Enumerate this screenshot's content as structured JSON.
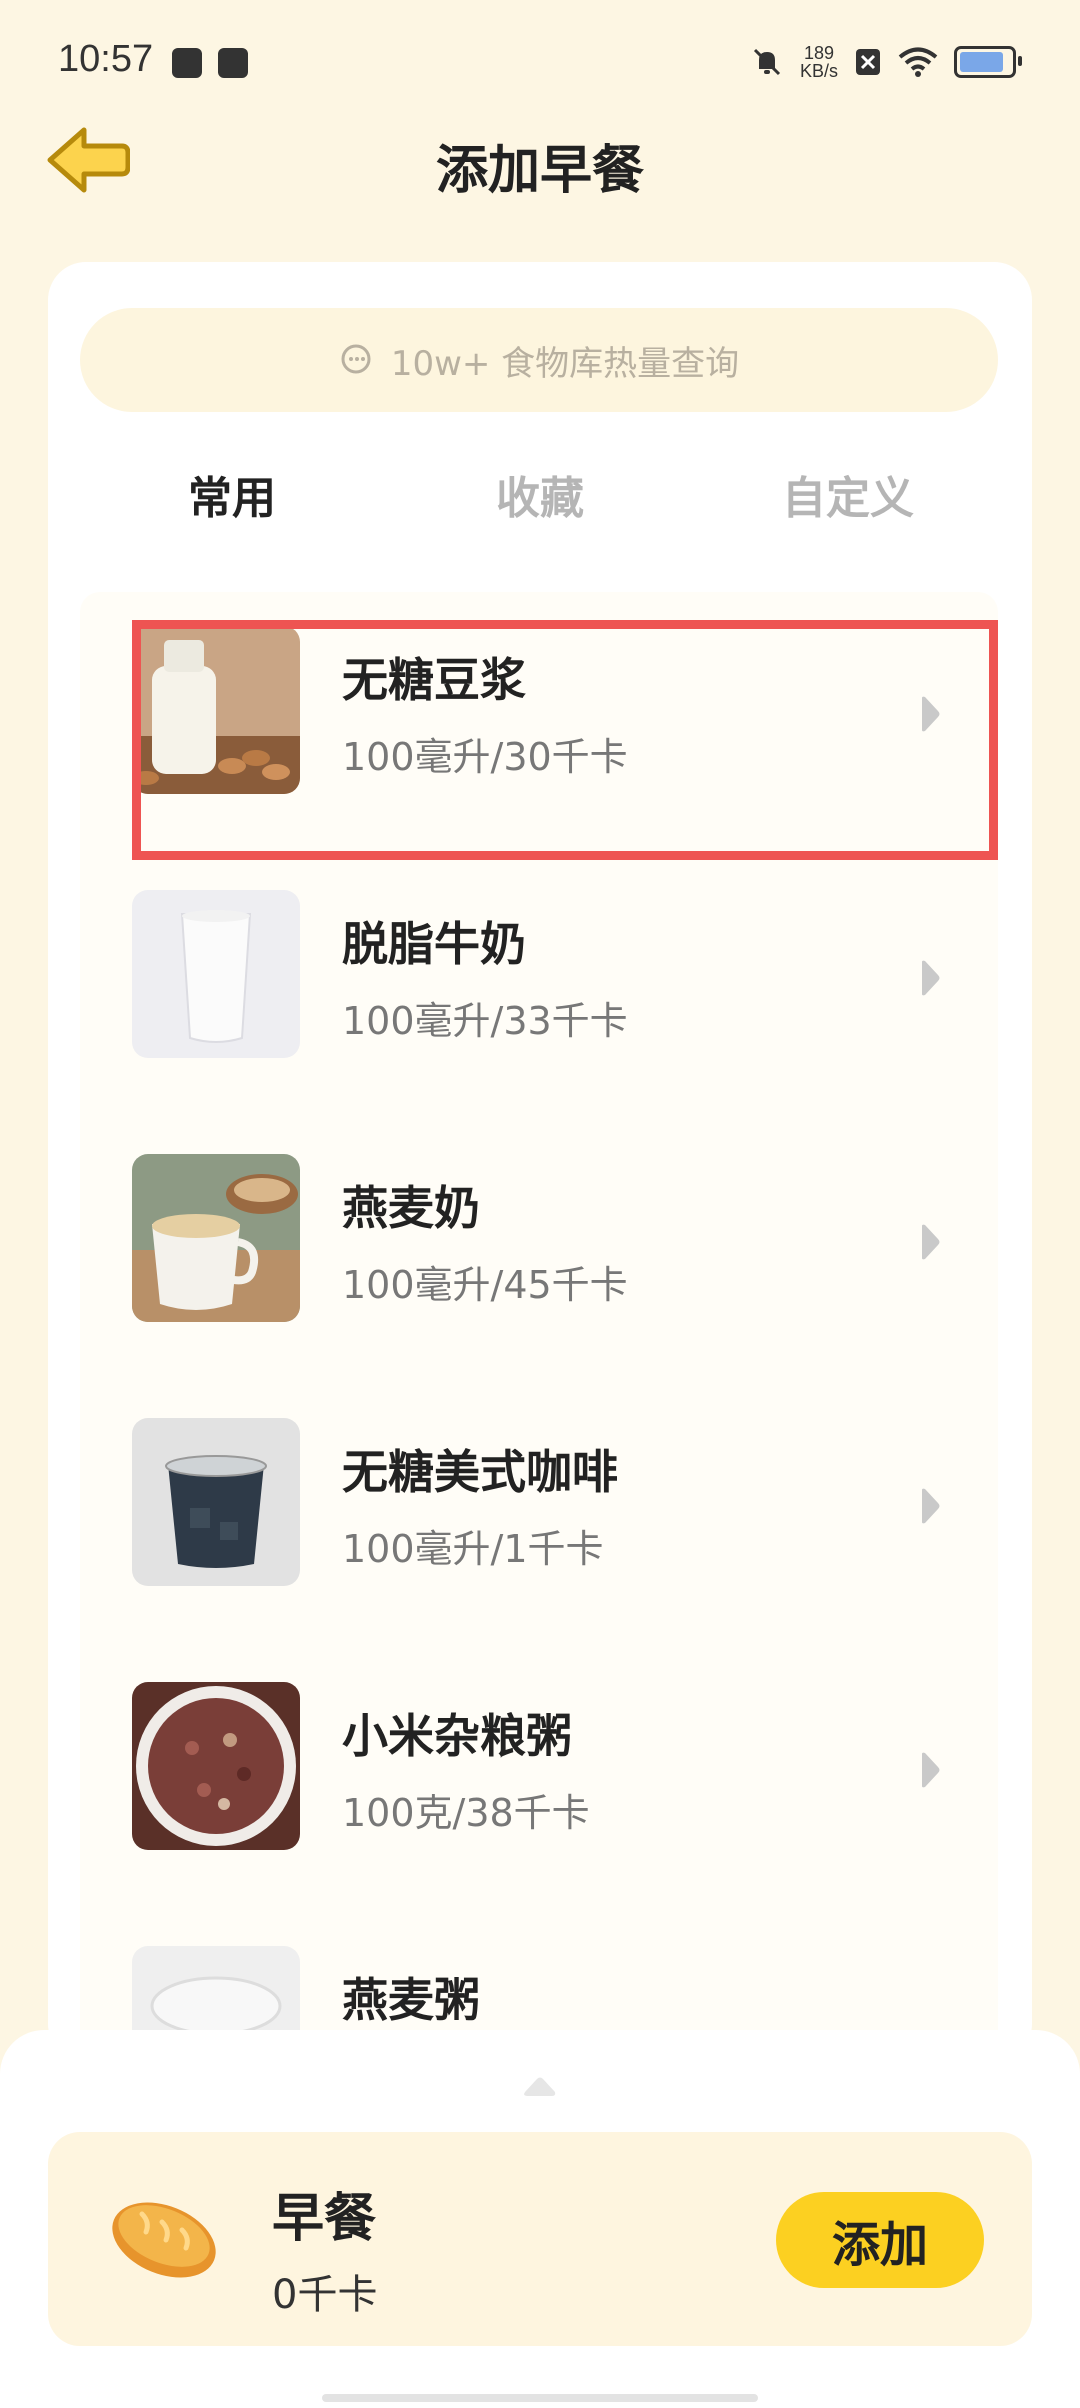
{
  "status_bar": {
    "time": "10:57",
    "net_speed_value": "189",
    "net_speed_unit": "KB/s",
    "battery_level": 0.85
  },
  "header": {
    "title": "添加早餐"
  },
  "search": {
    "placeholder": "10w+ 食物库热量查询"
  },
  "tabs": [
    {
      "label": "常用",
      "active": true
    },
    {
      "label": "收藏",
      "active": false
    },
    {
      "label": "自定义",
      "active": false
    }
  ],
  "foods": [
    {
      "name": "无糖豆浆",
      "info": "100毫升/30千卡",
      "image": "soy-milk-bottle"
    },
    {
      "name": "脱脂牛奶",
      "info": "100毫升/33千卡",
      "image": "milk-glass"
    },
    {
      "name": "燕麦奶",
      "info": "100毫升/45千卡",
      "image": "oat-milk-cup"
    },
    {
      "name": "无糖美式咖啡",
      "info": "100毫升/1千卡",
      "image": "iced-americano-cup"
    },
    {
      "name": "小米杂粮粥",
      "info": "100克/38千卡",
      "image": "grain-porridge-bowl"
    },
    {
      "name": "燕麦粥",
      "info": "",
      "image": "oat-porridge-bowl"
    }
  ],
  "meal_summary": {
    "name": "早餐",
    "calories": "0千卡",
    "add_label": "添加"
  },
  "colors": {
    "background": "#fdf6e3",
    "accent_yellow": "#fcd021",
    "highlight_red": "#ee5452"
  }
}
